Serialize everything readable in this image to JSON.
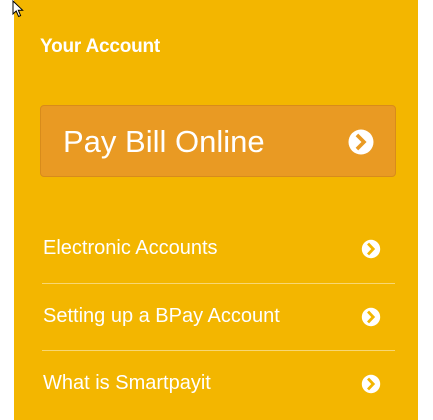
{
  "account": {
    "title": "Your Account",
    "pay_button_label": "Pay Bill Online",
    "links": [
      {
        "label": "Electronic Accounts"
      },
      {
        "label": "Setting up a BPay Account"
      },
      {
        "label": "What is Smartpayit"
      }
    ]
  },
  "colors": {
    "panel": "#f3b600",
    "pay_button": "#e99a23",
    "text": "#ffffff"
  },
  "icons": {
    "pay_button": "chevron-right-circle-icon",
    "link": "chevron-right-circle-icon",
    "cursor": "mouse-pointer-icon"
  }
}
